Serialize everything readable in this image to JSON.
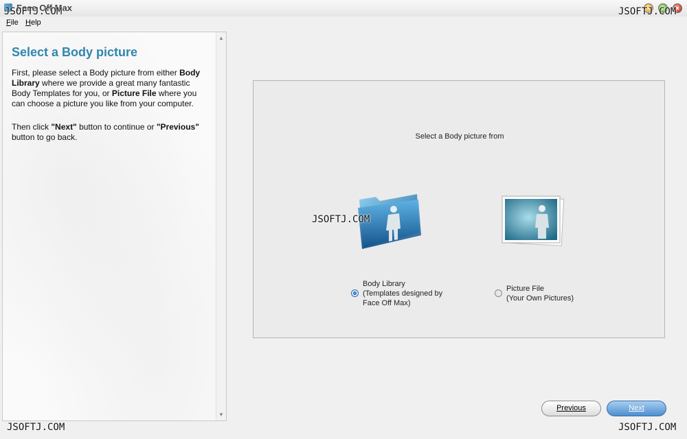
{
  "window": {
    "title": "Face Off Max",
    "controls": [
      "minimize-icon",
      "maximize-icon",
      "close-icon"
    ]
  },
  "menu": {
    "file": "File",
    "help": "Help"
  },
  "help_panel": {
    "title": "Select a Body picture",
    "p1": [
      {
        "t": "First, please select a Body picture from either ",
        "b": false
      },
      {
        "t": "Body Library",
        "b": true
      },
      {
        "t": " where we provide a great many fantastic Body Templates for you, or ",
        "b": false
      },
      {
        "t": "Picture File",
        "b": true
      },
      {
        "t": " where you can choose a picture you like from your computer.",
        "b": false
      }
    ],
    "p2": [
      {
        "t": "Then click ",
        "b": false
      },
      {
        "t": "\"Next\"",
        "b": true
      },
      {
        "t": " button to continue or ",
        "b": false
      },
      {
        "t": "\"Previous\"",
        "b": true
      },
      {
        "t": " button to go back.",
        "b": false
      }
    ]
  },
  "selection": {
    "heading": "Select a Body picture from",
    "options": [
      {
        "id": "library",
        "lines": [
          "Body Library",
          "(Templates designed by",
          "Face Off Max)"
        ],
        "selected": true,
        "icon": "folder-person-icon"
      },
      {
        "id": "file",
        "lines": [
          "Picture File",
          "(Your Own Pictures)"
        ],
        "selected": false,
        "icon": "photo-person-icon"
      }
    ]
  },
  "buttons": {
    "previous": "Previous",
    "next": "Next"
  },
  "watermark": "JSOFTJ.COM"
}
